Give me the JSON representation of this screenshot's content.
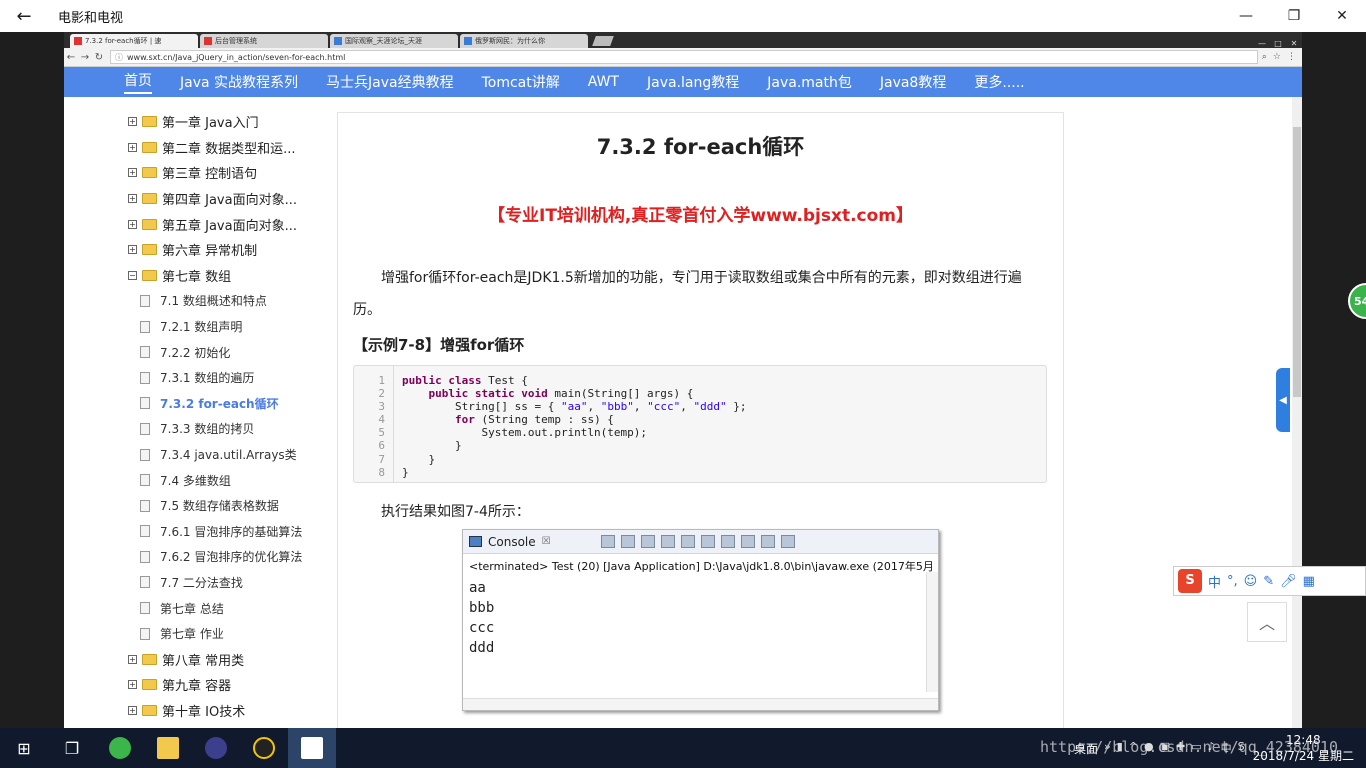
{
  "app": {
    "title": "电影和电视",
    "back": "←",
    "minimize": "—",
    "restore": "❐",
    "close": "✕"
  },
  "browser": {
    "tabs": [
      {
        "label": "7.3.2 for-each循环 | 速"
      },
      {
        "label": "后台管理系统"
      },
      {
        "label": "国际观察_天涯论坛_天涯"
      },
      {
        "label": "俄罗斯网民：为什么你"
      }
    ],
    "url": "www.sxt.cn/Java_jQuery_in_action/seven-for-each.html"
  },
  "sitenav": [
    "首页",
    "Java 实战教程系列",
    "马士兵Java经典教程",
    "Tomcat讲解",
    "AWT",
    "Java.lang教程",
    "Java.math包",
    "Java8教程",
    "更多....."
  ],
  "sidebar": {
    "chapters_before": [
      "第一章 Java入门",
      "第二章 数据类型和运...",
      "第三章 控制语句",
      "第四章 Java面向对象...",
      "第五章 Java面向对象...",
      "第六章 异常机制"
    ],
    "open_chapter": "第七章 数组",
    "sections": [
      "7.1 数组概述和特点",
      "7.2.1 数组声明",
      "7.2.2 初始化",
      "7.3.1 数组的遍历",
      "7.3.2 for-each循环",
      "7.3.3 数组的拷贝",
      "7.3.4 java.util.Arrays类",
      "7.4 多维数组",
      "7.5 数组存储表格数据",
      "7.6.1 冒泡排序的基础算法",
      "7.6.2 冒泡排序的优化算法",
      "7.7 二分法查找",
      "第七章 总结",
      "第七章 作业"
    ],
    "chapters_after": [
      "第八章 常用类",
      "第九章 容器",
      "第十章 IO技术"
    ]
  },
  "article": {
    "title": "7.3.2 for-each循环",
    "promo": "【专业IT培训机构,真正零首付入学www.bjsxt.com】",
    "paragraph": "增强for循环for-each是JDK1.5新增加的功能，专门用于读取数组或集合中所有的元素，即对数组进行遍历。",
    "example_title": "【示例7-8】增强for循环",
    "caption": "执行结果如图7-4所示："
  },
  "code": {
    "line_numbers": [
      "1",
      "2",
      "3",
      "4",
      "5",
      "6",
      "7",
      "8"
    ]
  },
  "console": {
    "tab": "Console",
    "status": "<terminated> Test (20) [Java Application] D:\\Java\\jdk1.8.0\\bin\\javaw.exe (2017年5月",
    "output": [
      "aa",
      "bbb",
      "ccc",
      "ddd"
    ]
  },
  "overlays": {
    "badge": "54",
    "ime": "中"
  },
  "taskbar": {
    "desktop_label": "桌面",
    "tray_text": "中",
    "time": "12:48",
    "date": "2018/7/24 星期二",
    "watermark": "https://blog.csdn.net/qq_42384010"
  }
}
